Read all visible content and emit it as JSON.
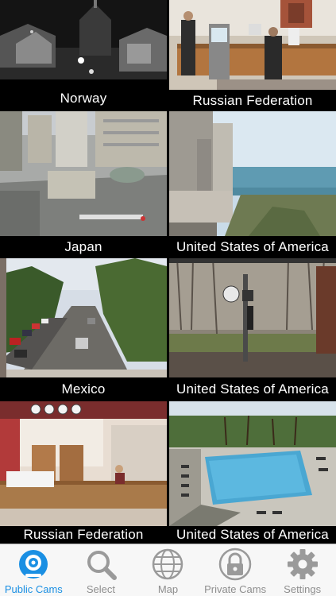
{
  "cameras": [
    {
      "country": "Norway"
    },
    {
      "country": "Russian Federation"
    },
    {
      "country": "Japan"
    },
    {
      "country": "United States of America"
    },
    {
      "country": "Mexico"
    },
    {
      "country": "United States of America"
    },
    {
      "country": "Russian Federation"
    },
    {
      "country": "United States of America"
    }
  ],
  "tabs": [
    {
      "label": "Public Cams",
      "icon": "webcam-icon",
      "active": true
    },
    {
      "label": "Select",
      "icon": "magnifier-icon",
      "active": false
    },
    {
      "label": "Map",
      "icon": "globe-icon",
      "active": false
    },
    {
      "label": "Private Cams",
      "icon": "padlock-icon",
      "active": false
    },
    {
      "label": "Settings",
      "icon": "gear-icon",
      "active": false
    }
  ],
  "colors": {
    "accent": "#1a8fe3",
    "inactive": "#8e8e8e",
    "tabbar_bg": "#f7f7f7"
  }
}
